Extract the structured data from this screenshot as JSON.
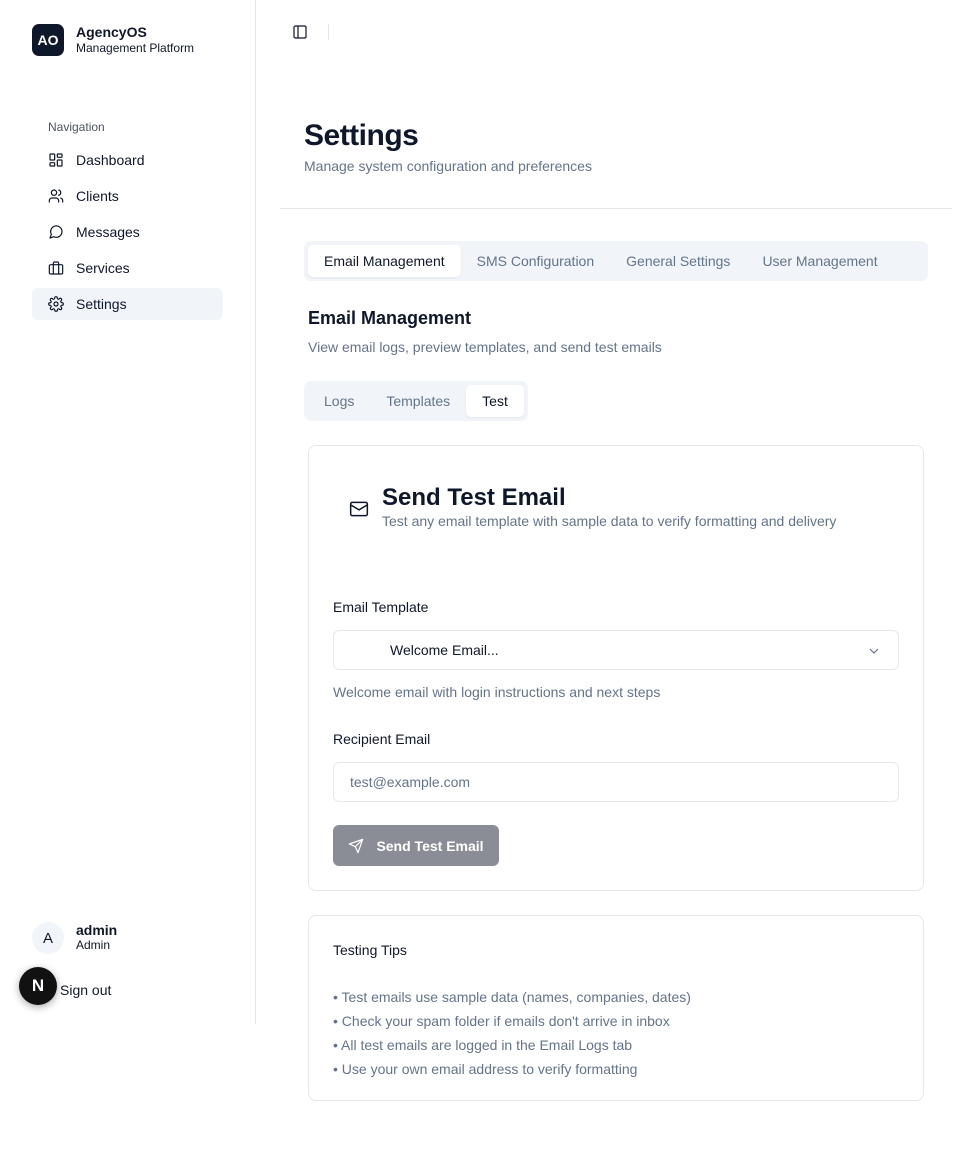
{
  "brand": {
    "logo": "AO",
    "name": "AgencyOS",
    "subtitle": "Management Platform"
  },
  "nav": {
    "label": "Navigation",
    "items": [
      {
        "label": "Dashboard",
        "icon": "dashboard-icon"
      },
      {
        "label": "Clients",
        "icon": "users-icon"
      },
      {
        "label": "Messages",
        "icon": "message-icon"
      },
      {
        "label": "Services",
        "icon": "briefcase-icon"
      },
      {
        "label": "Settings",
        "icon": "gear-icon",
        "active": true
      }
    ]
  },
  "user": {
    "initial": "A",
    "name": "admin",
    "role": "Admin",
    "signout": "Sign out"
  },
  "badge": "N",
  "page": {
    "title": "Settings",
    "subtitle": "Manage system configuration and preferences"
  },
  "tabs": [
    "Email Management",
    "SMS Configuration",
    "General Settings",
    "User Management"
  ],
  "section": {
    "title": "Email Management",
    "subtitle": "View email logs, preview templates, and send test emails"
  },
  "subtabs": [
    "Logs",
    "Templates",
    "Test"
  ],
  "test_card": {
    "title": "Send Test Email",
    "subtitle": "Test any email template with sample data to verify formatting and delivery",
    "template_label": "Email Template",
    "template_value": "Welcome Email...",
    "template_hint": "Welcome email with login instructions and next steps",
    "recipient_label": "Recipient Email",
    "recipient_placeholder": "test@example.com",
    "button": "Send Test Email"
  },
  "tips": {
    "title": "Testing Tips",
    "items": [
      "• Test emails use sample data (names, companies, dates)",
      "• Check your spam folder if emails don't arrive in inbox",
      "• All test emails are logged in the Email Logs tab",
      "• Use your own email address to verify formatting"
    ]
  }
}
